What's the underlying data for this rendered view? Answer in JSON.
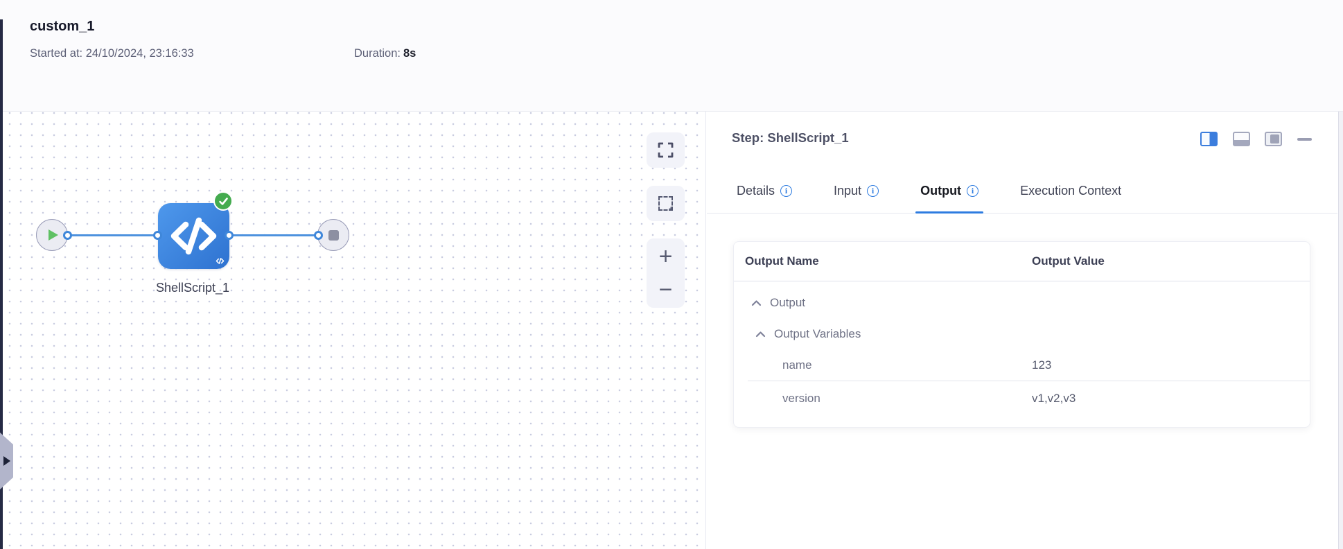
{
  "header": {
    "title": "custom_1",
    "started_label": "Started at:",
    "started_value": "24/10/2024, 23:16:33",
    "duration_label": "Duration:",
    "duration_value": "8s"
  },
  "canvas": {
    "node_label": "ShellScript_1",
    "zoom_in": "+",
    "zoom_out": "−",
    "icons": [
      "play-icon",
      "code-icon",
      "check-circle-icon",
      "stop-icon",
      "fullscreen-icon",
      "marquee-select-icon",
      "zoom-in-icon",
      "zoom-out-icon",
      "expand-panel-arrow-icon"
    ]
  },
  "panel": {
    "title": "Step: ShellScript_1",
    "tabs": [
      {
        "label": "Details",
        "has_info": true,
        "active": false
      },
      {
        "label": "Input",
        "has_info": true,
        "active": false
      },
      {
        "label": "Output",
        "has_info": true,
        "active": true
      },
      {
        "label": "Execution Context",
        "has_info": false,
        "active": false
      }
    ],
    "layout_icons": [
      "layout-split-right-icon",
      "layout-bottom-icon",
      "layout-right-filled-icon",
      "minimize-icon"
    ],
    "table": {
      "col_name": "Output Name",
      "col_value": "Output Value",
      "rows": [
        {
          "label": "Output",
          "type": "group",
          "value": ""
        },
        {
          "label": "Output Variables",
          "type": "group",
          "value": ""
        },
        {
          "label": "name",
          "type": "leaf",
          "value": "123"
        },
        {
          "label": "version",
          "type": "leaf",
          "value": "v1,v2,v3"
        }
      ],
      "row_icon": "chevron-up-icon"
    },
    "info_icon": "info-icon"
  },
  "colors": {
    "accent_blue": "#2e7ce0",
    "node_blue_start": "#4e98ec",
    "node_blue_end": "#2e72d0",
    "edge_blue": "#4e92de",
    "success_green": "#44ab4f",
    "canvas_dot": "#c9cce0",
    "dark_strip": "#252a44"
  }
}
